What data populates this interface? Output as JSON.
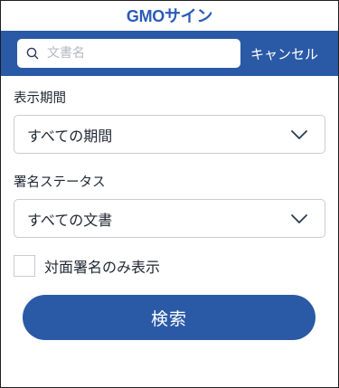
{
  "header": {
    "logo_text": "GMOサイン"
  },
  "search": {
    "placeholder": "文書名",
    "value": "",
    "cancel_label": "キャンセル"
  },
  "filters": {
    "period": {
      "label": "表示期間",
      "selected": "すべての期間"
    },
    "status": {
      "label": "署名ステータス",
      "selected": "すべての文書"
    },
    "face_to_face": {
      "label": "対面署名のみ表示",
      "checked": false
    }
  },
  "actions": {
    "search_label": "検索"
  },
  "colors": {
    "brand_blue": "#2a5aa6",
    "logo_blue": "#2a5bb7",
    "border_gray": "#c9ccd1",
    "text_dark": "#1f2733"
  }
}
